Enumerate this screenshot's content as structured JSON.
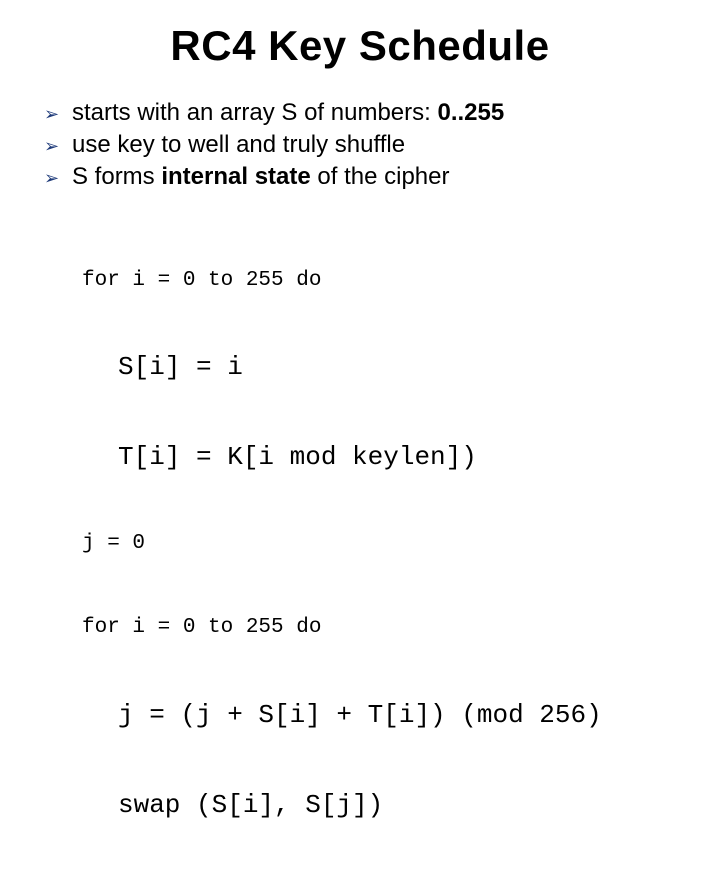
{
  "title": "RC4 Key Schedule",
  "bullets": {
    "b1_pre": "starts with an array S of numbers: ",
    "b1_bold": "0..255",
    "b2": "use key to well and truly shuffle",
    "b3_pre": "S forms ",
    "b3_bold": "internal state",
    "b3_post": " of the cipher"
  },
  "code": {
    "l1": "for i = 0 to 255 do",
    "l2": "S[i] = i",
    "l3": "T[i] = K[i mod keylen])",
    "l4": "j = 0",
    "l5": "for i = 0 to 255 do",
    "l6": "j = (j + S[i] + T[i]) (mod 256)",
    "l7": "swap (S[i], S[j])"
  }
}
